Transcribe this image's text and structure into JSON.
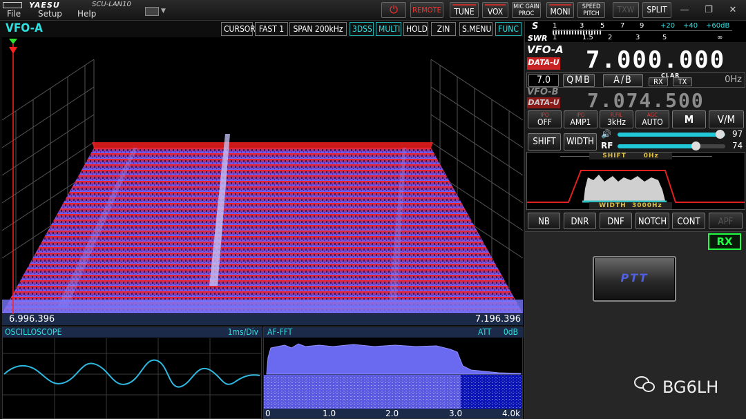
{
  "titlebar": {
    "brand": "YAESU",
    "app_name": "SCU-LAN10",
    "menu": [
      "File",
      "Setup",
      "Help"
    ],
    "buttons": {
      "power": "⏻",
      "remote": "REMOTE",
      "tune": "TUNE",
      "vox": "VOX",
      "mic_gain_proc": [
        "MIC GAIN",
        "PROC"
      ],
      "moni": "MONI",
      "speed_pitch": [
        "SPEED",
        "PITCH"
      ],
      "txw": "TXW",
      "split": "SPLIT"
    },
    "window_controls": [
      "—",
      "❐",
      "✕"
    ]
  },
  "spectrum": {
    "vfo_label": "VFO-A",
    "controls": [
      "CURSOR",
      "FAST 1",
      "SPAN  200kHz",
      "3DSS",
      "MULTI",
      "HOLD",
      "ZIN",
      "S.MENU",
      "FUNC"
    ],
    "freq_left": "6.996.396",
    "freq_right": "7.196.396"
  },
  "oscilloscope": {
    "label": "OSCILLOSCOPE",
    "scale": "1ms/Div"
  },
  "af_fft": {
    "label": "AF-FFT",
    "att_label": "ATT",
    "att_value": "0dB",
    "axis": [
      "0",
      "1.0",
      "2.0",
      "3.0",
      "4.0k"
    ]
  },
  "meter": {
    "s_label": "S",
    "s_scale": [
      "1",
      "3",
      "5",
      "7",
      "9",
      "+20",
      "+40",
      "+60dB"
    ],
    "swr_label": "SWR",
    "swr_scale": [
      "1",
      "1.5",
      "2",
      "3",
      "5",
      "∞"
    ]
  },
  "vfo_a": {
    "label": "VFO-A",
    "mode": "DATA-U",
    "frequency": "7.000.000"
  },
  "band_row": {
    "band": "7.0",
    "qmb": "QMB",
    "ab": "A/B",
    "clar_label": "CLAR",
    "rx": "RX",
    "tx": "TX",
    "offset": "0Hz"
  },
  "vfo_b": {
    "label": "VFO-B",
    "mode": "DATA-U",
    "frequency": "7.074.500"
  },
  "func_buttons": [
    {
      "top": "IPO",
      "bottom": "OFF"
    },
    {
      "top": "IPO",
      "bottom": "AMP1"
    },
    {
      "top": "R.FIL",
      "bottom": "3kHz"
    },
    {
      "top": "AGC",
      "bottom": "AUTO"
    }
  ],
  "m_button": "M",
  "vm_button": "V/M",
  "shift_button": "SHIFT",
  "width_button": "WIDTH",
  "af_gain": {
    "icon": "speaker",
    "value": "97"
  },
  "rf_gain": {
    "label": "RF",
    "value": "74"
  },
  "filter": {
    "shift_label": "SHIFT",
    "shift_value": "0Hz",
    "width_label": "WIDTH",
    "width_value": "3000Hz"
  },
  "dsp_buttons": [
    "NB",
    "DNR",
    "DNF",
    "NOTCH",
    "CONT",
    "APF"
  ],
  "rx_indicator": "RX",
  "ptt_button": "PTT",
  "watermark": "BG6LH",
  "colors": {
    "accent_cyan": "#2fe0e0",
    "spectrum_top": "#ff2020",
    "spectrum_bottom": "#7070ff",
    "rx_green": "#20ff40",
    "mode_red": "#c92222"
  }
}
